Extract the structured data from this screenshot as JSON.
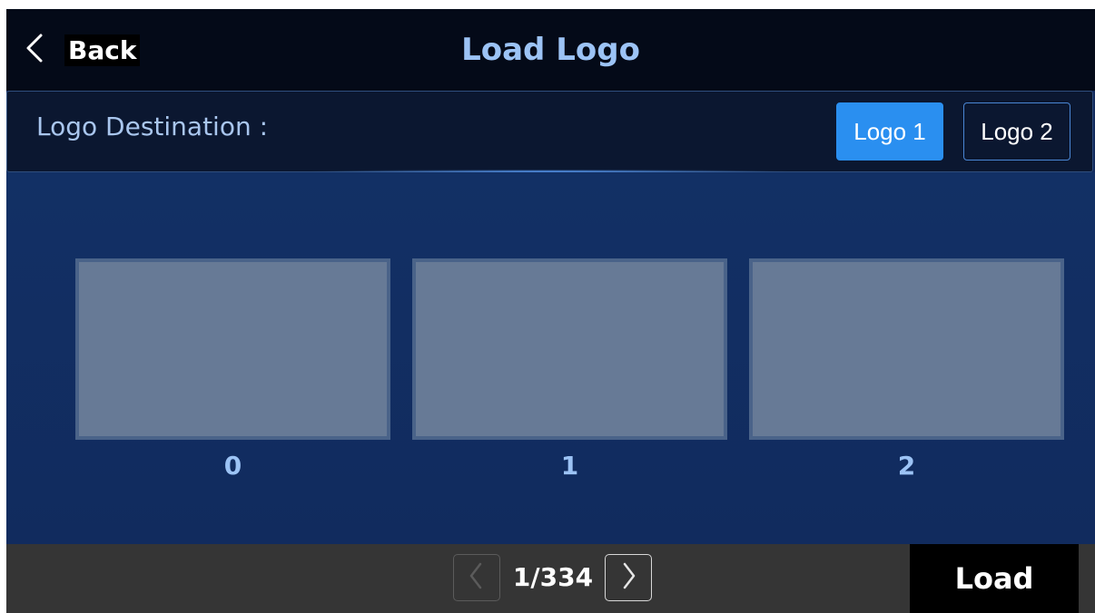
{
  "header": {
    "back_label": "Back",
    "title": "Load Logo",
    "back_icon": "chevron-left-icon"
  },
  "destination": {
    "label": "Logo Destination :",
    "options": [
      {
        "label": "Logo 1",
        "selected": true
      },
      {
        "label": "Logo 2",
        "selected": false
      }
    ]
  },
  "slots": [
    {
      "label": "0"
    },
    {
      "label": "1"
    },
    {
      "label": "2"
    }
  ],
  "footer": {
    "page_indicator": "1/334",
    "prev_icon": "chevron-left-icon",
    "next_icon": "chevron-right-icon",
    "load_label": "Load"
  },
  "colors": {
    "accent": "#2a8ff0",
    "title": "#9cc3f5",
    "header_bg": "#040a18",
    "content_bg": "#122a5c",
    "footer_bg": "#353535"
  }
}
